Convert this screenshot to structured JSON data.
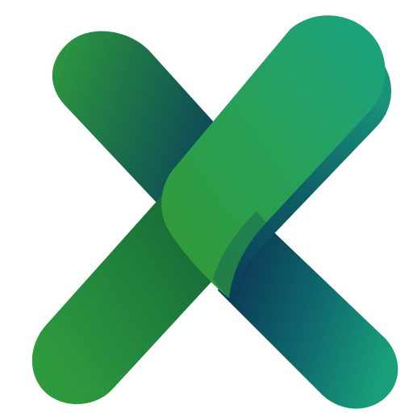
{
  "logo": {
    "icon_name": "x-letter-logo-icon",
    "colors": {
      "background": "#ffffff",
      "bright_green": "#2e9a3e",
      "mid_green": "#1f7f3c",
      "teal": "#19a07a",
      "dark_teal": "#0e4a5c",
      "deep_navy_teal": "#0b3d58"
    }
  }
}
